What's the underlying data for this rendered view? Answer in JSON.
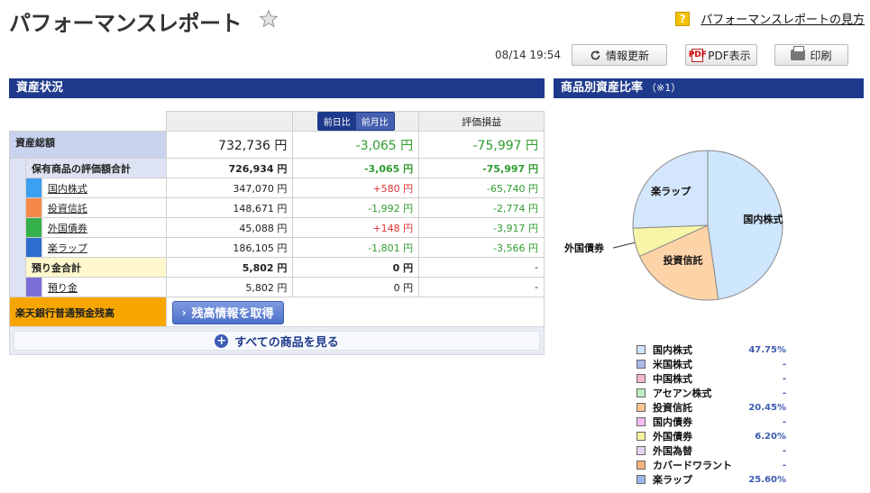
{
  "header": {
    "title": "パフォーマンスレポート",
    "help_icon": "?",
    "help_link": "パフォーマンスレポートの見方"
  },
  "toolbar": {
    "timestamp": "08/14 19:54",
    "refresh_label": "情報更新",
    "pdf_icon": "PDF",
    "pdf_label": "PDF表示",
    "print_label": "印刷"
  },
  "left_section": {
    "title": "資産状況"
  },
  "right_section": {
    "title": "商品別資産比率",
    "note": "（※1）"
  },
  "table": {
    "toggle": {
      "day": "前日比",
      "month": "前月比"
    },
    "col_pl": "評価損益",
    "total": {
      "label": "資産総額",
      "value": "732,736 円",
      "change": "-3,065 円",
      "pl": "-75,997 円"
    },
    "holdings": {
      "label": "保有商品の評価額合計",
      "value": "726,934 円",
      "change": "-3,065 円",
      "pl": "-75,997 円"
    },
    "items": [
      {
        "name": "国内株式",
        "value": "347,070 円",
        "change": "+580 円",
        "pl": "-65,740 円",
        "color": "#3aa0f0",
        "change_sign": "pos"
      },
      {
        "name": "投資信託",
        "value": "148,671 円",
        "change": "-1,992 円",
        "pl": "-2,774 円",
        "color": "#f5894a",
        "change_sign": "neg"
      },
      {
        "name": "外国債券",
        "value": "45,088 円",
        "change": "+148 円",
        "pl": "-3,917 円",
        "color": "#34b04a",
        "change_sign": "pos"
      },
      {
        "name": "楽ラップ",
        "value": "186,105 円",
        "change": "-1,801 円",
        "pl": "-3,566 円",
        "color": "#2c6ed0",
        "change_sign": "neg"
      }
    ],
    "deposit_total": {
      "label": "預り金合計",
      "value": "5,802 円",
      "change": "0 円",
      "pl": "-"
    },
    "deposit": {
      "name": "預り金",
      "value": "5,802 円",
      "change": "0 円",
      "pl": "-",
      "color": "#7b6fd6"
    },
    "bank": {
      "label": "楽天銀行普通預金残高",
      "button": "残高情報を取得"
    }
  },
  "all_products": {
    "label": "すべての商品を見る"
  },
  "chart_data": {
    "type": "pie",
    "series": [
      {
        "name": "国内株式",
        "value": 47.75,
        "color": "#cfe6ff"
      },
      {
        "name": "投資信託",
        "value": 20.45,
        "color": "#fdd3a8"
      },
      {
        "name": "外国債券",
        "value": 6.2,
        "color": "#f7f5a8"
      },
      {
        "name": "楽ラップ",
        "value": 25.6,
        "color": "#d3e6fb"
      }
    ]
  },
  "legend": [
    {
      "name": "国内株式",
      "value": "47.75%",
      "color": "#cfe6ff"
    },
    {
      "name": "米国株式",
      "value": "-",
      "color": "#aab9ea"
    },
    {
      "name": "中国株式",
      "value": "-",
      "color": "#f7b8cf"
    },
    {
      "name": "アセアン株式",
      "value": "-",
      "color": "#bfeec0"
    },
    {
      "name": "投資信託",
      "value": "20.45%",
      "color": "#fcc48f"
    },
    {
      "name": "国内債券",
      "value": "-",
      "color": "#f2bdf0"
    },
    {
      "name": "外国債券",
      "value": "6.20%",
      "color": "#f5f3a0"
    },
    {
      "name": "外国為替",
      "value": "-",
      "color": "#e6d4f5"
    },
    {
      "name": "カバードワラント",
      "value": "-",
      "color": "#f7b27a"
    },
    {
      "name": "楽ラップ",
      "value": "25.60%",
      "color": "#9bb8e8"
    }
  ]
}
